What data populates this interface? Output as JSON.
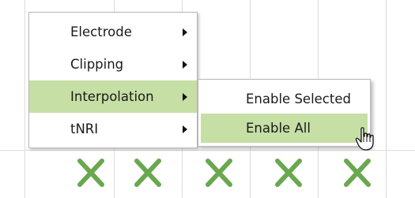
{
  "menu": {
    "items": [
      {
        "label": "Electrode",
        "has_submenu": true
      },
      {
        "label": "Clipping",
        "has_submenu": true
      },
      {
        "label": "Interpolation",
        "has_submenu": true,
        "highlighted": true
      },
      {
        "label": "tNRI",
        "has_submenu": true
      }
    ]
  },
  "submenu": {
    "items": [
      {
        "label": "Enable Selected"
      },
      {
        "label": "Enable All",
        "highlighted": true
      }
    ]
  },
  "grid": {
    "row_markers": [
      "x-mark-icon",
      "x-mark-icon",
      "x-mark-icon",
      "x-mark-icon",
      "x-mark-icon"
    ]
  },
  "colors": {
    "highlight": "#c6dfa5",
    "marker": "#6aa84f",
    "grid_line": "#dcdcdc"
  },
  "cursor": {
    "icon": "hand-pointer-icon"
  }
}
